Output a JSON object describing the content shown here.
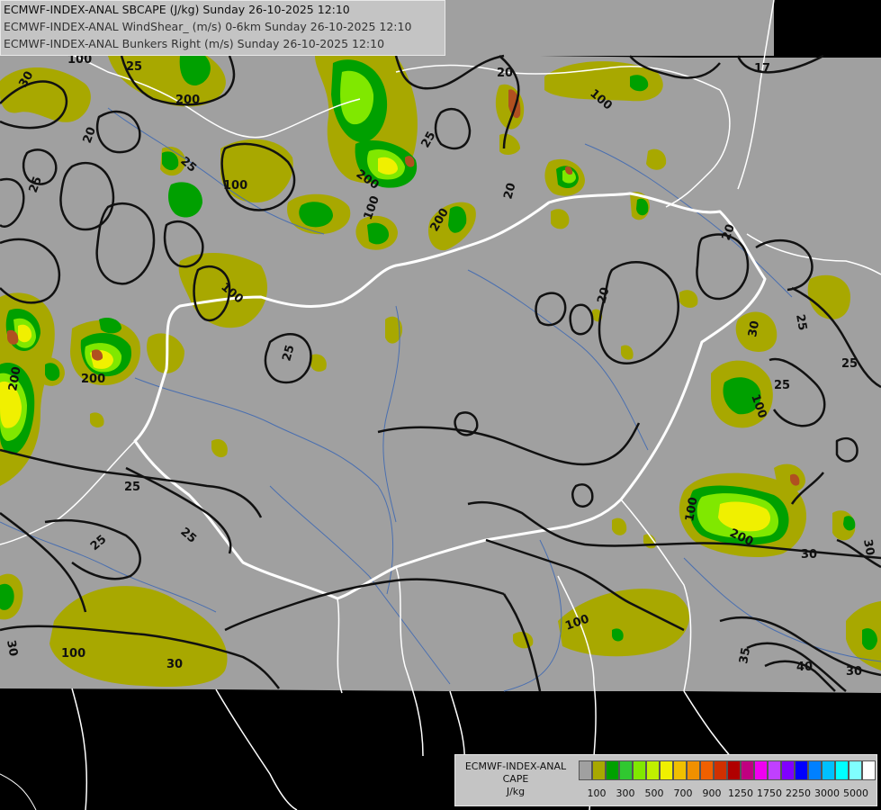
{
  "header": {
    "line1": "ECMWF-INDEX-ANAL SBCAPE (J/kg) Sunday 26-10-2025 12:10",
    "line2": "ECMWF-INDEX-ANAL WindShear_ (m/s) 0-6km Sunday 26-10-2025 12:10",
    "line3": "ECMWF-INDEX-ANAL Bunkers Right (m/s) Sunday 26-10-2025 12:10"
  },
  "legend": {
    "title_line1": "ECMWF-INDEX-ANAL",
    "title_line2": "CAPE",
    "title_line3": "J/kg",
    "colors": [
      "#a0a0a0",
      "#a8a800",
      "#00a000",
      "#30c830",
      "#80e800",
      "#c0f000",
      "#f0f000",
      "#f0c000",
      "#f09000",
      "#f06000",
      "#d03000",
      "#b00000",
      "#c00080",
      "#f000f0",
      "#c040ff",
      "#8000ff",
      "#0000ff",
      "#0080ff",
      "#00c0ff",
      "#00ffff",
      "#80ffff",
      "#ffffff"
    ],
    "tick_labels": [
      "100",
      "300",
      "500",
      "700",
      "900",
      "1250",
      "1750",
      "2250",
      "3000",
      "5000"
    ]
  },
  "colors": {
    "background": "#000000",
    "domain": "#a0a0a0",
    "cape_low": "#a8a800",
    "cape_mid": "#00a000",
    "cape_high": "#80e800",
    "cape_peak": "#f0f000",
    "cape_max": "#b05020",
    "contour": "#111111",
    "border": "#ffffff",
    "rivers": "#4a6fb0"
  },
  "contour_labels": [
    "30",
    "25",
    "100",
    "200",
    "20",
    "25",
    "100",
    "200",
    "17",
    "20",
    "100",
    "25",
    "200",
    "20",
    "20",
    "20",
    "25",
    "200",
    "25",
    "25",
    "100",
    "200",
    "25",
    "25",
    "100",
    "30",
    "200",
    "100",
    "30",
    "30",
    "100",
    "25",
    "25",
    "30",
    "100",
    "30",
    "35",
    "40",
    "30",
    "100",
    "25"
  ]
}
